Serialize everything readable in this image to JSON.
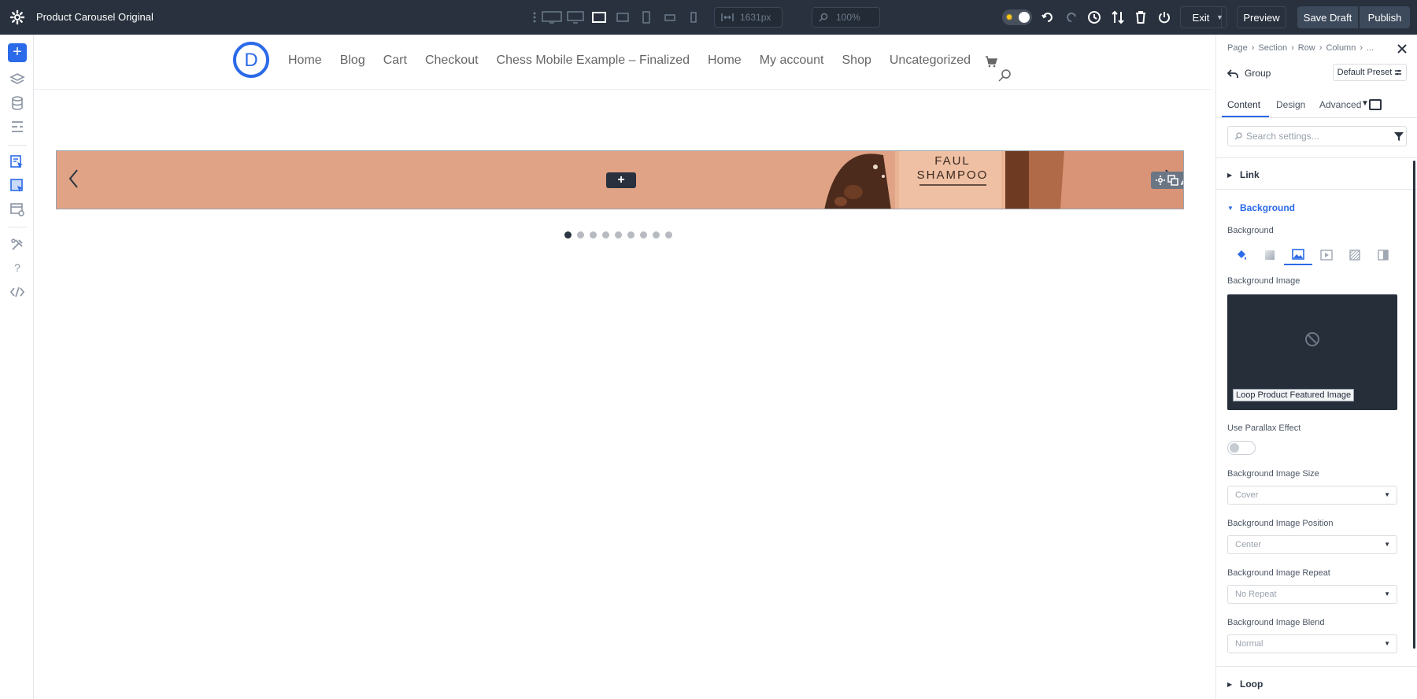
{
  "topbar": {
    "title": "Product Carousel Original",
    "width_value": "1631px",
    "zoom_value": "100%",
    "exit_label": "Exit",
    "preview_label": "Preview",
    "save_draft_label": "Save Draft",
    "publish_label": "Publish"
  },
  "site": {
    "logo_letter": "D",
    "nav": [
      "Home",
      "Blog",
      "Cart",
      "Checkout",
      "Chess Mobile Example – Finalized",
      "Home",
      "My account",
      "Shop",
      "Uncategorized"
    ],
    "brand_color": "#2b6ae8"
  },
  "carousel": {
    "product_text_line1": "FAUL",
    "product_text_line2": "SHAMPOO",
    "add_label": "+",
    "dot_count": 9,
    "active_dot": 0,
    "background_color": "#e0a385"
  },
  "panel": {
    "breadcrumbs": [
      "Page",
      "Section",
      "Row",
      "Column",
      "..."
    ],
    "back_label": "Group",
    "preset_label": "Default Preset",
    "tabs": [
      "Content",
      "Design",
      "Advanced"
    ],
    "active_tab": "Content",
    "search_placeholder": "Search settings...",
    "groups": {
      "link": "Link",
      "background": "Background",
      "loop": "Loop"
    },
    "fields": {
      "background_label": "Background",
      "background_image_label": "Background Image",
      "image_tag": "Loop Product Featured Image",
      "parallax_label": "Use Parallax Effect",
      "size_label": "Background Image Size",
      "size_value": "Cover",
      "position_label": "Background Image Position",
      "position_value": "Center",
      "repeat_label": "Background Image Repeat",
      "repeat_value": "No Repeat",
      "blend_label": "Background Image Blend",
      "blend_value": "Normal"
    },
    "background_type_icons": [
      "paint-bucket-icon",
      "gradient-icon",
      "image-icon",
      "video-icon",
      "pattern-icon",
      "mask-icon"
    ],
    "active_background_type": "image-icon",
    "parallax_enabled": false
  }
}
